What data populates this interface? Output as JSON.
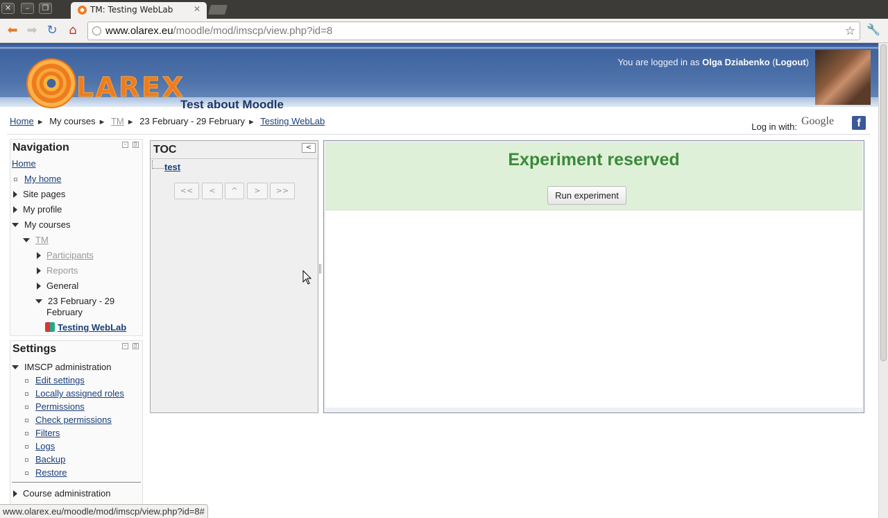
{
  "browser": {
    "tab_title": "TM: Testing WebLab",
    "url_host": "www.olarex.eu",
    "url_path": "/moodle/mod/imscp/view.php?id=8",
    "status_url": "www.olarex.eu/moodle/mod/imscp/view.php?id=8#"
  },
  "header": {
    "logo_text": "LAREX",
    "site_title": "Test about Moodle",
    "login_prefix": "You are logged in as",
    "user_name": "Olga Dziabenko",
    "logout": "Logout",
    "login_with": "Log in with:",
    "google": "Google",
    "facebook": "f"
  },
  "breadcrumb": {
    "items": [
      "Home",
      "My courses",
      "TM",
      "23 February - 29 February",
      "Testing WebLab"
    ],
    "separator": "►"
  },
  "navigation": {
    "title": "Navigation",
    "home": "Home",
    "my_home": "My home",
    "site_pages": "Site pages",
    "my_profile": "My profile",
    "my_courses": "My courses",
    "tm": "TM",
    "participants": "Participants",
    "reports": "Reports",
    "general": "General",
    "week_line1": "23 February - 29",
    "week_line2": "February",
    "current": "Testing WebLab"
  },
  "settings": {
    "title": "Settings",
    "imscp_admin": "IMSCP administration",
    "items": [
      "Edit settings",
      "Locally assigned roles",
      "Permissions",
      "Check permissions",
      "Filters",
      "Logs",
      "Backup",
      "Restore"
    ],
    "course_admin": "Course administration"
  },
  "toc": {
    "title": "TOC",
    "item": "test",
    "buttons": [
      "<<",
      "<",
      "^",
      ">",
      ">>"
    ]
  },
  "content": {
    "heading": "Experiment reserved",
    "run_button": "Run experiment"
  },
  "colors": {
    "header_blue": "#3f64a0",
    "brand_orange": "#f07b1f",
    "reserved_green_bg": "#dff0d8",
    "reserved_green_text": "#3b8a3b"
  }
}
